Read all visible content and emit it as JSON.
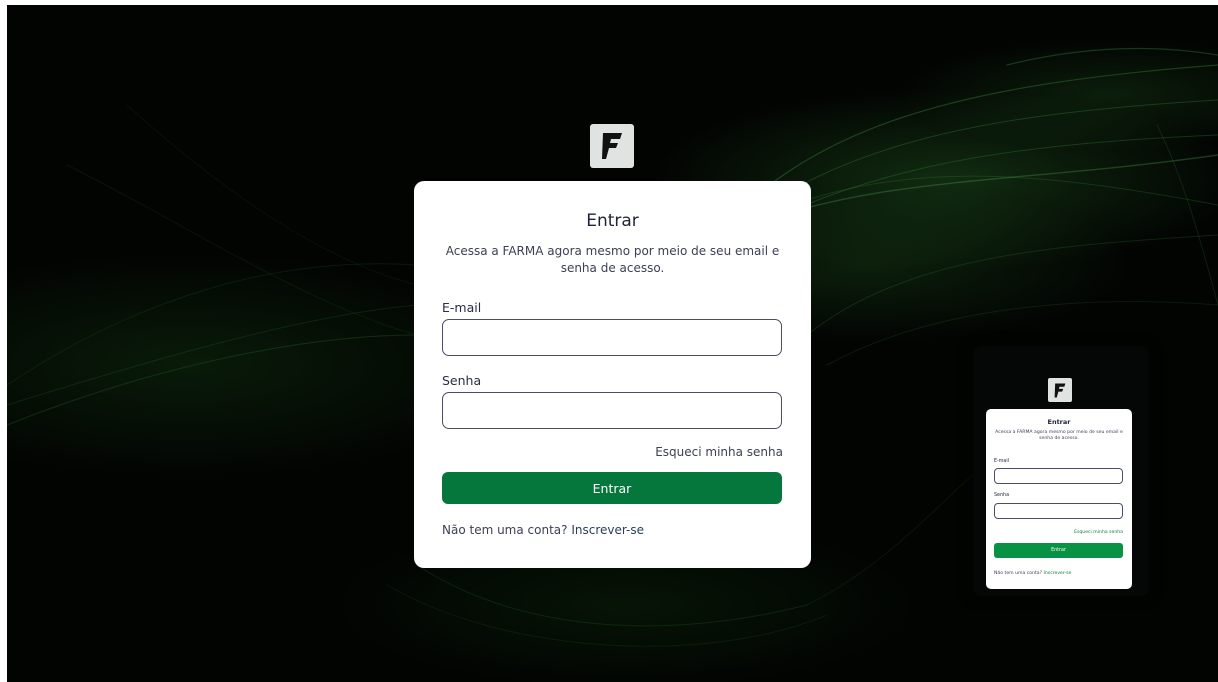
{
  "brand": {
    "logo_letter": "F",
    "logo_bg": "#dfe3e1",
    "logo_fg": "#111111"
  },
  "login": {
    "title": "Entrar",
    "subtitle": "Acessa a FARMA agora mesmo por meio de seu email e senha de acesso.",
    "email_label": "E-mail",
    "email_value": "",
    "password_label": "Senha",
    "password_value": "",
    "forgot_label": "Esqueci minha senha",
    "submit_label": "Entrar",
    "signup_prompt": "Não tem uma conta?",
    "signup_link": "Inscrever-se"
  },
  "preview": {
    "title": "Entrar",
    "subtitle": "Acessa a FARMA agora mesmo por meio de seu email e senha de acesso.",
    "email_label": "E-mail",
    "password_label": "Senha",
    "forgot_label": "Esqueci minha senha",
    "submit_label": "Entrar",
    "signup_prompt": "Não tem uma conta?",
    "signup_link": "Inscrever-se"
  },
  "colors": {
    "primary_button": "#06773c",
    "preview_link": "#0a7d3e",
    "background": "#020402",
    "accent_glow": "#2d782d"
  }
}
